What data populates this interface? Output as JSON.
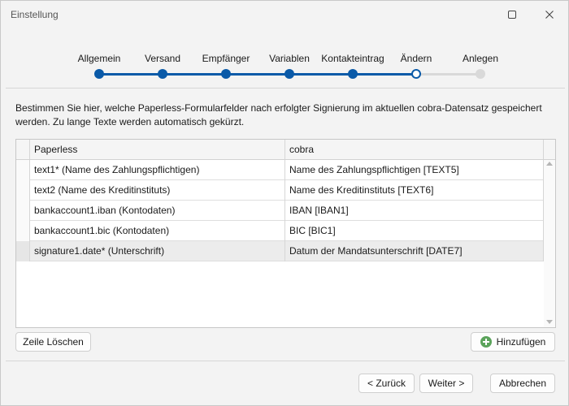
{
  "window": {
    "title": "Einstellung"
  },
  "steps": [
    {
      "label": "Allgemein",
      "state": "done"
    },
    {
      "label": "Versand",
      "state": "done"
    },
    {
      "label": "Empfänger",
      "state": "done"
    },
    {
      "label": "Variablen",
      "state": "done"
    },
    {
      "label": "Kontakteintrag",
      "state": "done"
    },
    {
      "label": "Ändern",
      "state": "current"
    },
    {
      "label": "Anlegen",
      "state": "todo"
    }
  ],
  "description": "Bestimmen Sie hier, welche Paperless-Formularfelder nach erfolgter Signierung im aktuellen cobra-Datensatz gespeichert werden. Zu lange Texte werden automatisch gekürzt.",
  "grid": {
    "columns": [
      "Paperless",
      "cobra"
    ],
    "rows": [
      {
        "paperless": "text1* (Name des Zahlungspflichtigen)",
        "cobra": "Name des Zahlungspflichtigen [TEXT5]"
      },
      {
        "paperless": "text2 (Name des Kreditinstituts)",
        "cobra": "Name des Kreditinstituts [TEXT6]"
      },
      {
        "paperless": "bankaccount1.iban (Kontodaten)",
        "cobra": "IBAN [IBAN1]"
      },
      {
        "paperless": "bankaccount1.bic (Kontodaten)",
        "cobra": "BIC [BIC1]"
      },
      {
        "paperless": "signature1.date* (Unterschrift)",
        "cobra": "Datum der Mandatsunterschrift [DATE7]",
        "selected": true
      }
    ]
  },
  "buttons": {
    "delete_row": "Zeile Löschen",
    "add": "Hinzufügen",
    "back": "< Zurück",
    "next": "Weiter >",
    "cancel": "Abbrechen"
  },
  "colors": {
    "accent": "#0a5aa8",
    "step_todo": "#d9d9d9",
    "add_icon": "#5ba35b"
  },
  "icons": {
    "maximize": "maximize-icon",
    "close": "close-icon",
    "add": "plus-circle-icon"
  }
}
